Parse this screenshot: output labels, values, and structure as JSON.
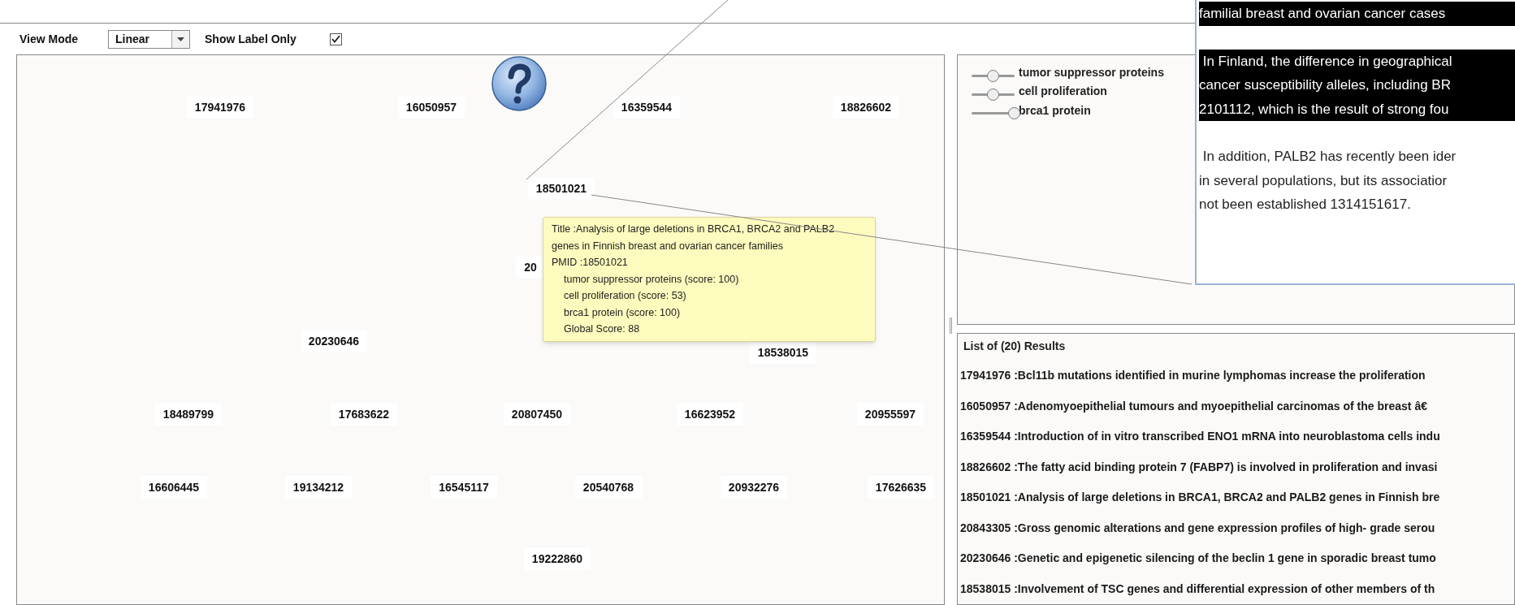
{
  "toolbar": {
    "view_mode_label": "View Mode",
    "view_mode": "Linear",
    "show_label_only_label": "Show Label Only",
    "show_label_only": true
  },
  "graph": {
    "nodes": [
      {
        "label": "17941976"
      },
      {
        "label": "16050957"
      },
      {
        "label": "16359544"
      },
      {
        "label": "18826602"
      },
      {
        "label": "18501021"
      },
      {
        "label": "20"
      },
      {
        "label": "20230646"
      },
      {
        "label": "18538015"
      },
      {
        "label": "18489799"
      },
      {
        "label": "17683622"
      },
      {
        "label": "20807450"
      },
      {
        "label": "16623952"
      },
      {
        "label": "20955597"
      },
      {
        "label": "16606445"
      },
      {
        "label": "19134212"
      },
      {
        "label": "16545117"
      },
      {
        "label": "20540768"
      },
      {
        "label": "20932276"
      },
      {
        "label": "17626635"
      },
      {
        "label": "19222860"
      }
    ],
    "tooltip": {
      "title": "Title :Analysis of large deletions in BRCA1, BRCA2 and PALB2 genes in Finnish breast and ovarian cancer families",
      "pmid": "PMID :18501021",
      "scores": [
        "tumor suppressor proteins (score: 100)",
        "cell proliferation (score: 53)",
        "brca1 protein (score: 100)"
      ],
      "global": "Global Score: 88"
    }
  },
  "keywords": [
    {
      "label": "tumor suppressor proteins",
      "level": 0.5
    },
    {
      "label": "cell proliferation",
      "level": 0.5
    },
    {
      "label": "brca1 protein",
      "level": 1
    }
  ],
  "abstract_popup": {
    "paragraphs": [
      {
        "highlighted": true,
        "lines": [
          "familial breast and ovarian cancer cases"
        ]
      },
      {
        "highlighted": true,
        "lines": [
          " In Finland, the difference in geographical",
          "cancer susceptibility alleles, including BR",
          "2101112, which is the result of strong fou"
        ]
      },
      {
        "highlighted": false,
        "lines": [
          " In addition, PALB2 has recently been ider",
          "in several populations, but its associatior",
          "not been established 1314151617."
        ]
      }
    ]
  },
  "results": {
    "title": "List of (20) Results",
    "items": [
      "17941976 :Bcl11b mutations identified in murine lymphomas increase the proliferation",
      "16050957 :Adenomyoepithelial tumours and myoepithelial carcinomas of the breast â€",
      "16359544 :Introduction of in vitro transcribed ENO1 mRNA into neuroblastoma cells indu",
      "18826602 :The fatty acid binding protein 7 (FABP7) is involved in proliferation and invasi",
      "18501021 :Analysis of large deletions in BRCA1, BRCA2 and PALB2 genes in Finnish bre",
      "20843305 :Gross genomic alterations and gene expression profiles of high- grade serou",
      "20230646 :Genetic and epigenetic silencing of the beclin 1 gene in sporadic breast tumo",
      "18538015 :Involvement of TSC genes and differential expression of other members of th"
    ]
  }
}
